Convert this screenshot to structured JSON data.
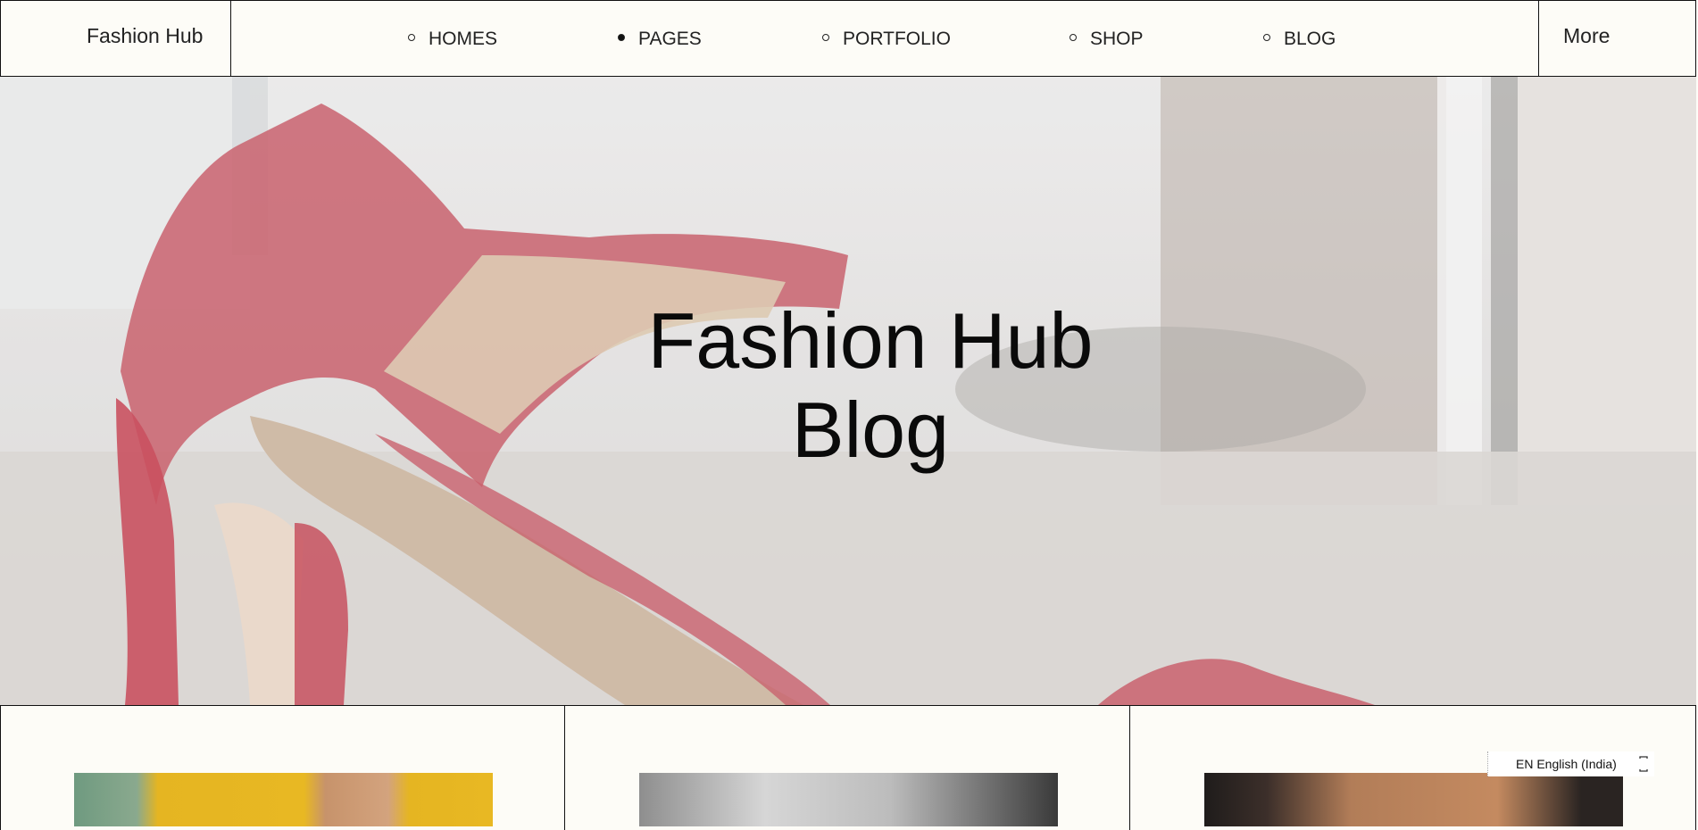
{
  "header": {
    "logo": "Fashion Hub",
    "nav": [
      {
        "label": "HOMES",
        "active": false
      },
      {
        "label": "PAGES",
        "active": true
      },
      {
        "label": "PORTFOLIO",
        "active": false
      },
      {
        "label": "SHOP",
        "active": false
      },
      {
        "label": "BLOG",
        "active": false
      }
    ],
    "more": "More"
  },
  "hero": {
    "title_line1": "Fashion Hub",
    "title_line2": "Blog"
  },
  "language_indicator": "EN English (India)",
  "icons": {
    "nav_bullet": "circle-bullet-icon",
    "lang_toggle": "language-bar-icon"
  },
  "colors": {
    "background": "#fdfcf7",
    "border": "#111111",
    "shoe_red": "#c24c5a"
  }
}
